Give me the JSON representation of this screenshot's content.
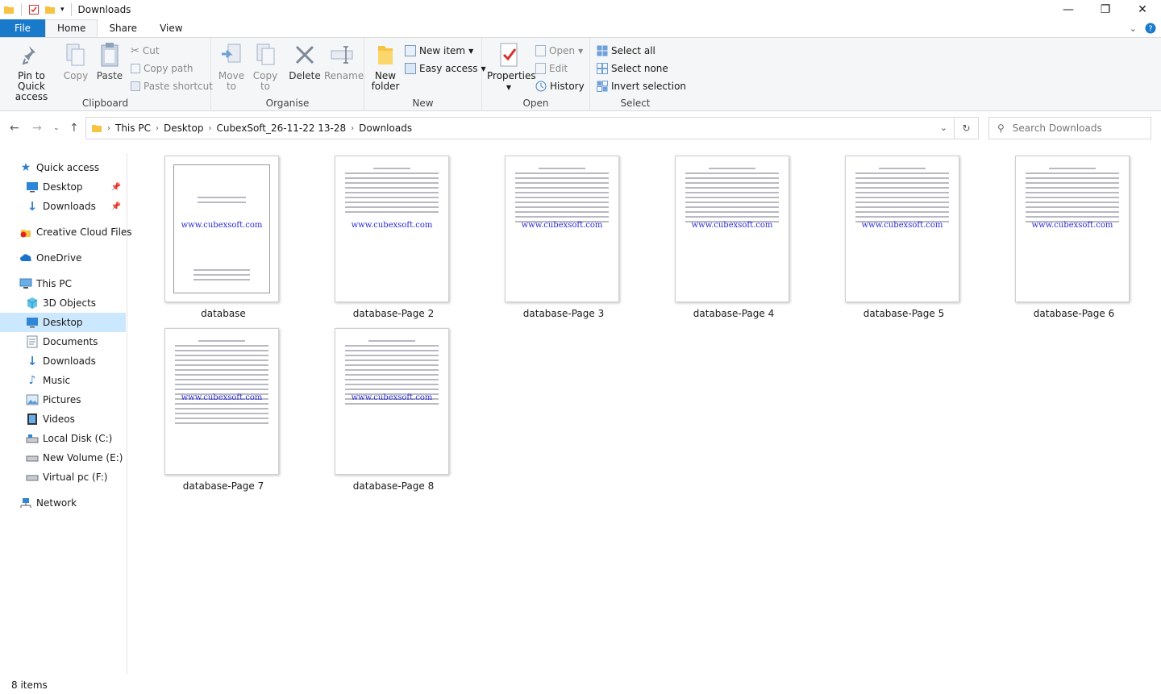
{
  "window": {
    "title": "Downloads"
  },
  "tabs": {
    "file": "File",
    "home": "Home",
    "share": "Share",
    "view": "View"
  },
  "ribbon": {
    "clipboard": {
      "label": "Clipboard",
      "pin": "Pin to Quick access",
      "copy": "Copy",
      "paste": "Paste",
      "cut": "Cut",
      "copy_path": "Copy path",
      "paste_shortcut": "Paste shortcut"
    },
    "organise": {
      "label": "Organise",
      "move_to": "Move to",
      "copy_to": "Copy to",
      "delete": "Delete",
      "rename": "Rename"
    },
    "new": {
      "label": "New",
      "new_folder": "New folder",
      "new_item": "New item",
      "easy_access": "Easy access"
    },
    "open": {
      "label": "Open",
      "properties": "Properties",
      "open": "Open",
      "edit": "Edit",
      "history": "History"
    },
    "select": {
      "label": "Select",
      "select_all": "Select all",
      "select_none": "Select none",
      "invert": "Invert selection"
    }
  },
  "address": {
    "crumbs": [
      "This PC",
      "Desktop",
      "CubexSoft_26-11-22 13-28",
      "Downloads"
    ]
  },
  "search": {
    "placeholder": "Search Downloads"
  },
  "sidebar": [
    {
      "label": "Quick access",
      "icon": "star-icon"
    },
    {
      "label": "Desktop",
      "icon": "desktop-icon",
      "pinned": true
    },
    {
      "label": "Downloads",
      "icon": "download-icon",
      "pinned": true
    },
    {
      "label": "Creative Cloud Files",
      "icon": "creative-cloud-icon"
    },
    {
      "label": "OneDrive",
      "icon": "cloud-icon"
    },
    {
      "label": "This PC",
      "icon": "computer-icon"
    },
    {
      "label": "3D Objects",
      "icon": "cube-icon"
    },
    {
      "label": "Desktop",
      "icon": "desktop-icon",
      "selected": true
    },
    {
      "label": "Documents",
      "icon": "document-icon"
    },
    {
      "label": "Downloads",
      "icon": "download-icon"
    },
    {
      "label": "Music",
      "icon": "music-icon"
    },
    {
      "label": "Pictures",
      "icon": "picture-icon"
    },
    {
      "label": "Videos",
      "icon": "video-icon"
    },
    {
      "label": "Local Disk (C:)",
      "icon": "drive-icon"
    },
    {
      "label": "New Volume (E:)",
      "icon": "drive-icon"
    },
    {
      "label": "Virtual pc (F:)",
      "icon": "drive-icon"
    },
    {
      "label": "Network",
      "icon": "network-icon"
    }
  ],
  "files": [
    {
      "name": "database",
      "watermark": "www.cubexsoft.com"
    },
    {
      "name": "database-Page 2",
      "watermark": "www.cubexsoft.com"
    },
    {
      "name": "database-Page 3",
      "watermark": "www.cubexsoft.com"
    },
    {
      "name": "database-Page 4",
      "watermark": "www.cubexsoft.com"
    },
    {
      "name": "database-Page 5",
      "watermark": "www.cubexsoft.com"
    },
    {
      "name": "database-Page 6",
      "watermark": "www.cubexsoft.com"
    },
    {
      "name": "database-Page 7",
      "watermark": "www.cubexsoft.com"
    },
    {
      "name": "database-Page 8",
      "watermark": "www.cubexsoft.com"
    }
  ],
  "status": {
    "items": "8 items"
  }
}
